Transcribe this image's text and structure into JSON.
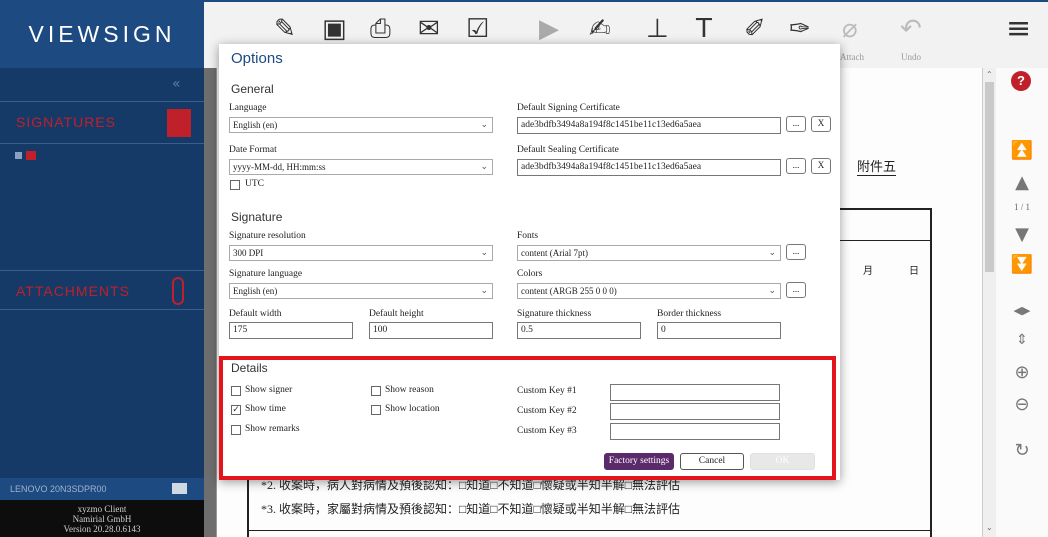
{
  "sidebar": {
    "logo": "VIEWSIGN",
    "collapse_icon": "double-chevron-left",
    "signatures_label": "SIGNATURES",
    "attachments_label": "ATTACHMENTS",
    "device": "LENOVO 20N3SDPR00",
    "client": "xyzmo Client",
    "company": "Namirial GmbH",
    "version": "Version 20.28.0.6143"
  },
  "toolbar": {
    "attach_label": "Attach",
    "undo_label": "Undo"
  },
  "doc": {
    "page_indicator": "1 / 1",
    "header_label": "附件五",
    "month": "月",
    "day": "日",
    "line1": "*2. 收案時，病人對病情及預後認知：□知道□不知道□懷疑或半知半解□無法評估",
    "line2": "*3. 收案時，家屬對病情及預後認知：□知道□不知道□懷疑或半知半解□無法評估"
  },
  "dialog": {
    "title": "Options",
    "general": {
      "heading": "General",
      "language_label": "Language",
      "language_value": "English (en)",
      "date_format_label": "Date Format",
      "date_format_value": "yyyy-MM-dd, HH:mm:ss",
      "utc_label": "UTC",
      "utc_checked": false,
      "signing_cert_label": "Default Signing Certificate",
      "signing_cert_value": "ade3bdfb3494a8a194f8c1451be11c13ed6a5aea",
      "sealing_cert_label": "Default Sealing Certificate",
      "sealing_cert_value": "ade3bdfb3494a8a194f8c1451be11c13ed6a5aea",
      "browse_label": "...",
      "clear_label": "X"
    },
    "signature": {
      "heading": "Signature",
      "resolution_label": "Signature resolution",
      "resolution_value": "300 DPI",
      "language_label": "Signature language",
      "language_value": "English (en)",
      "fonts_label": "Fonts",
      "fonts_value": "content (Arial 7pt)",
      "colors_label": "Colors",
      "colors_value": "content (ARGB 255 0 0 0)",
      "width_label": "Default width",
      "width_value": "175",
      "height_label": "Default height",
      "height_value": "100",
      "thickness_label": "Signature thickness",
      "thickness_value": "0.5",
      "border_label": "Border thickness",
      "border_value": "0"
    },
    "details": {
      "heading": "Details",
      "show_signer": {
        "label": "Show signer",
        "checked": false
      },
      "show_reason": {
        "label": "Show reason",
        "checked": false
      },
      "show_time": {
        "label": "Show time",
        "checked": true
      },
      "show_location": {
        "label": "Show location",
        "checked": false
      },
      "show_remarks": {
        "label": "Show remarks",
        "checked": false
      },
      "key1_label": "Custom Key #1",
      "key2_label": "Custom Key #2",
      "key3_label": "Custom Key #3",
      "key1_value": "",
      "key2_value": "",
      "key3_value": ""
    },
    "buttons": {
      "factory": "Factory settings",
      "cancel": "Cancel",
      "ok": "OK"
    }
  },
  "colors": {
    "sidebar": "#153a68",
    "accent_red": "#c0202a",
    "factory_button": "#5b2a6b",
    "highlight": "#e3141b"
  }
}
